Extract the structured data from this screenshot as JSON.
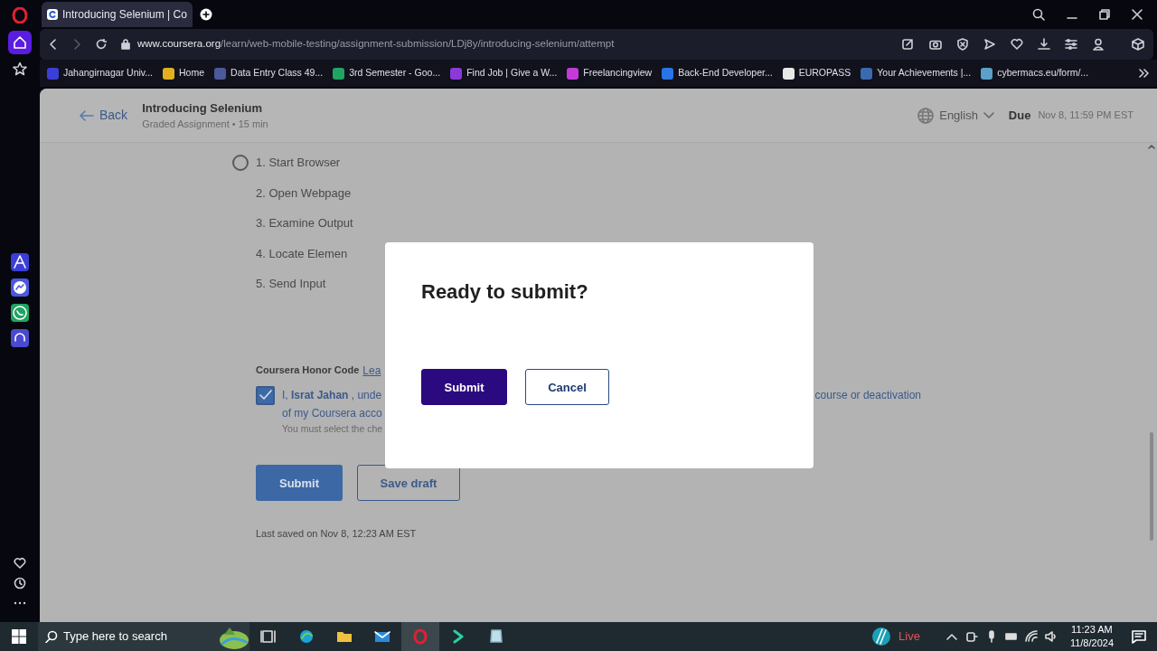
{
  "browser": {
    "tabs": [
      {
        "title": "Introducing Selenium | Co",
        "selected": true
      }
    ],
    "url_host": "www.coursera.org",
    "url_path": "/learn/web-mobile-testing/assignment-submission/LDj8y/introducing-selenium/attempt",
    "bookmarks": [
      {
        "label": "Jahangirnagar Univ...",
        "color": "#3b3fd8"
      },
      {
        "label": "Home",
        "color": "#e0b020"
      },
      {
        "label": "Data Entry Class 49...",
        "color": "#4a5a9a"
      },
      {
        "label": "3rd Semester - Goo...",
        "color": "#1fa463"
      },
      {
        "label": "Find Job | Give a W...",
        "color": "#8a3ad8"
      },
      {
        "label": "Freelancingview",
        "color": "#c23ad8"
      },
      {
        "label": "Back-End Developer...",
        "color": "#2a73e8"
      },
      {
        "label": "EUROPASS",
        "color": "#e8e8e8"
      },
      {
        "label": "Your Achievements |...",
        "color": "#3a6ab0"
      },
      {
        "label": "cybermacs.eu/form/...",
        "color": "#5aa0c8"
      }
    ]
  },
  "page": {
    "back": "Back",
    "title": "Introducing Selenium",
    "subtitle": "Graded Assignment • 15 min",
    "language": "English",
    "due_label": "Due",
    "due": "Nov 8, 11:59 PM EST",
    "options": [
      {
        "label": "1. Start Browser",
        "kind": "radio",
        "selected": false
      },
      {
        "label": "2. Open Webpage",
        "kind": "plain"
      },
      {
        "label": "3. Examine Output",
        "kind": "plain"
      },
      {
        "label": "4. Locate Elemen",
        "kind": "plain"
      },
      {
        "label": "5. Send Input",
        "kind": "plain"
      }
    ],
    "honor": {
      "title": "Coursera Honor Code",
      "link": "Lea",
      "checked": true,
      "statement_start": "I, **Israt Jahan** , unde",
      "statement_end": "course or deactivation",
      "statement_line2": "of my Coursera acco",
      "hint": "You must select the che"
    },
    "buttons": [
      {
        "label": "Submit",
        "kind": "primary"
      },
      {
        "label": "Save draft",
        "kind": "outline"
      }
    ],
    "last_saved": "Last saved on Nov 8, 12:23 AM EST"
  },
  "dialog": {
    "title": "Ready to submit?",
    "buttons": [
      {
        "label": "Submit",
        "kind": "primary"
      },
      {
        "label": "Cancel",
        "kind": "outline"
      }
    ]
  },
  "taskbar": {
    "search_placeholder": "Type here to search",
    "live": "Live",
    "time": "11:23 AM",
    "date": "11/8/2024"
  }
}
